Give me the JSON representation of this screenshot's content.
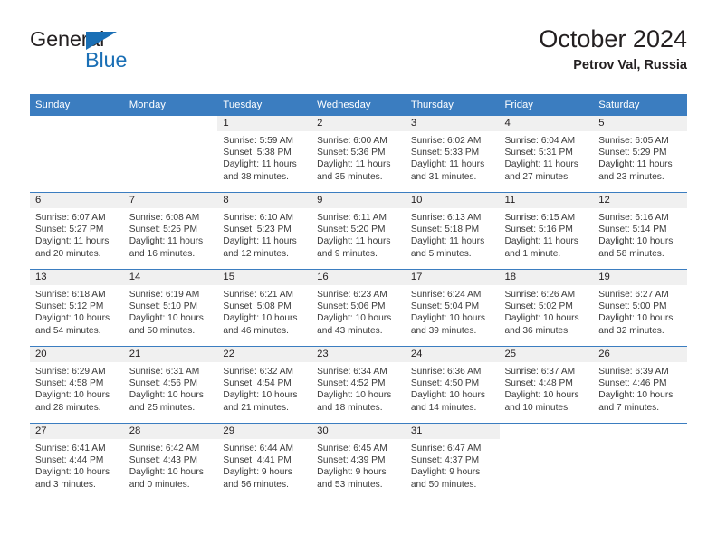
{
  "logo": {
    "word_primary": "General",
    "word_secondary": "Blue",
    "triangle_color": "#1a6fb5",
    "primary_color": "#231f20"
  },
  "header": {
    "title": "October 2024",
    "subtitle": "Petrov Val, Russia",
    "accent_color": "#3b7dc0"
  },
  "weekdays": [
    "Sunday",
    "Monday",
    "Tuesday",
    "Wednesday",
    "Thursday",
    "Friday",
    "Saturday"
  ],
  "labels": {
    "sunrise_prefix": "Sunrise:",
    "sunset_prefix": "Sunset:",
    "daylight_prefix": "Daylight:"
  },
  "weeks": [
    [
      {
        "day": "",
        "blank": true,
        "sunrise": "",
        "sunset": "",
        "daylight_line1": "",
        "daylight_line2": ""
      },
      {
        "day": "",
        "blank": true,
        "sunrise": "",
        "sunset": "",
        "daylight_line1": "",
        "daylight_line2": ""
      },
      {
        "day": "1",
        "sunrise": "Sunrise: 5:59 AM",
        "sunset": "Sunset: 5:38 PM",
        "daylight_line1": "Daylight: 11 hours",
        "daylight_line2": "and 38 minutes."
      },
      {
        "day": "2",
        "sunrise": "Sunrise: 6:00 AM",
        "sunset": "Sunset: 5:36 PM",
        "daylight_line1": "Daylight: 11 hours",
        "daylight_line2": "and 35 minutes."
      },
      {
        "day": "3",
        "sunrise": "Sunrise: 6:02 AM",
        "sunset": "Sunset: 5:33 PM",
        "daylight_line1": "Daylight: 11 hours",
        "daylight_line2": "and 31 minutes."
      },
      {
        "day": "4",
        "sunrise": "Sunrise: 6:04 AM",
        "sunset": "Sunset: 5:31 PM",
        "daylight_line1": "Daylight: 11 hours",
        "daylight_line2": "and 27 minutes."
      },
      {
        "day": "5",
        "sunrise": "Sunrise: 6:05 AM",
        "sunset": "Sunset: 5:29 PM",
        "daylight_line1": "Daylight: 11 hours",
        "daylight_line2": "and 23 minutes."
      }
    ],
    [
      {
        "day": "6",
        "sunrise": "Sunrise: 6:07 AM",
        "sunset": "Sunset: 5:27 PM",
        "daylight_line1": "Daylight: 11 hours",
        "daylight_line2": "and 20 minutes."
      },
      {
        "day": "7",
        "sunrise": "Sunrise: 6:08 AM",
        "sunset": "Sunset: 5:25 PM",
        "daylight_line1": "Daylight: 11 hours",
        "daylight_line2": "and 16 minutes."
      },
      {
        "day": "8",
        "sunrise": "Sunrise: 6:10 AM",
        "sunset": "Sunset: 5:23 PM",
        "daylight_line1": "Daylight: 11 hours",
        "daylight_line2": "and 12 minutes."
      },
      {
        "day": "9",
        "sunrise": "Sunrise: 6:11 AM",
        "sunset": "Sunset: 5:20 PM",
        "daylight_line1": "Daylight: 11 hours",
        "daylight_line2": "and 9 minutes."
      },
      {
        "day": "10",
        "sunrise": "Sunrise: 6:13 AM",
        "sunset": "Sunset: 5:18 PM",
        "daylight_line1": "Daylight: 11 hours",
        "daylight_line2": "and 5 minutes."
      },
      {
        "day": "11",
        "sunrise": "Sunrise: 6:15 AM",
        "sunset": "Sunset: 5:16 PM",
        "daylight_line1": "Daylight: 11 hours",
        "daylight_line2": "and 1 minute."
      },
      {
        "day": "12",
        "sunrise": "Sunrise: 6:16 AM",
        "sunset": "Sunset: 5:14 PM",
        "daylight_line1": "Daylight: 10 hours",
        "daylight_line2": "and 58 minutes."
      }
    ],
    [
      {
        "day": "13",
        "sunrise": "Sunrise: 6:18 AM",
        "sunset": "Sunset: 5:12 PM",
        "daylight_line1": "Daylight: 10 hours",
        "daylight_line2": "and 54 minutes."
      },
      {
        "day": "14",
        "sunrise": "Sunrise: 6:19 AM",
        "sunset": "Sunset: 5:10 PM",
        "daylight_line1": "Daylight: 10 hours",
        "daylight_line2": "and 50 minutes."
      },
      {
        "day": "15",
        "sunrise": "Sunrise: 6:21 AM",
        "sunset": "Sunset: 5:08 PM",
        "daylight_line1": "Daylight: 10 hours",
        "daylight_line2": "and 46 minutes."
      },
      {
        "day": "16",
        "sunrise": "Sunrise: 6:23 AM",
        "sunset": "Sunset: 5:06 PM",
        "daylight_line1": "Daylight: 10 hours",
        "daylight_line2": "and 43 minutes."
      },
      {
        "day": "17",
        "sunrise": "Sunrise: 6:24 AM",
        "sunset": "Sunset: 5:04 PM",
        "daylight_line1": "Daylight: 10 hours",
        "daylight_line2": "and 39 minutes."
      },
      {
        "day": "18",
        "sunrise": "Sunrise: 6:26 AM",
        "sunset": "Sunset: 5:02 PM",
        "daylight_line1": "Daylight: 10 hours",
        "daylight_line2": "and 36 minutes."
      },
      {
        "day": "19",
        "sunrise": "Sunrise: 6:27 AM",
        "sunset": "Sunset: 5:00 PM",
        "daylight_line1": "Daylight: 10 hours",
        "daylight_line2": "and 32 minutes."
      }
    ],
    [
      {
        "day": "20",
        "sunrise": "Sunrise: 6:29 AM",
        "sunset": "Sunset: 4:58 PM",
        "daylight_line1": "Daylight: 10 hours",
        "daylight_line2": "and 28 minutes."
      },
      {
        "day": "21",
        "sunrise": "Sunrise: 6:31 AM",
        "sunset": "Sunset: 4:56 PM",
        "daylight_line1": "Daylight: 10 hours",
        "daylight_line2": "and 25 minutes."
      },
      {
        "day": "22",
        "sunrise": "Sunrise: 6:32 AM",
        "sunset": "Sunset: 4:54 PM",
        "daylight_line1": "Daylight: 10 hours",
        "daylight_line2": "and 21 minutes."
      },
      {
        "day": "23",
        "sunrise": "Sunrise: 6:34 AM",
        "sunset": "Sunset: 4:52 PM",
        "daylight_line1": "Daylight: 10 hours",
        "daylight_line2": "and 18 minutes."
      },
      {
        "day": "24",
        "sunrise": "Sunrise: 6:36 AM",
        "sunset": "Sunset: 4:50 PM",
        "daylight_line1": "Daylight: 10 hours",
        "daylight_line2": "and 14 minutes."
      },
      {
        "day": "25",
        "sunrise": "Sunrise: 6:37 AM",
        "sunset": "Sunset: 4:48 PM",
        "daylight_line1": "Daylight: 10 hours",
        "daylight_line2": "and 10 minutes."
      },
      {
        "day": "26",
        "sunrise": "Sunrise: 6:39 AM",
        "sunset": "Sunset: 4:46 PM",
        "daylight_line1": "Daylight: 10 hours",
        "daylight_line2": "and 7 minutes."
      }
    ],
    [
      {
        "day": "27",
        "sunrise": "Sunrise: 6:41 AM",
        "sunset": "Sunset: 4:44 PM",
        "daylight_line1": "Daylight: 10 hours",
        "daylight_line2": "and 3 minutes."
      },
      {
        "day": "28",
        "sunrise": "Sunrise: 6:42 AM",
        "sunset": "Sunset: 4:43 PM",
        "daylight_line1": "Daylight: 10 hours",
        "daylight_line2": "and 0 minutes."
      },
      {
        "day": "29",
        "sunrise": "Sunrise: 6:44 AM",
        "sunset": "Sunset: 4:41 PM",
        "daylight_line1": "Daylight: 9 hours",
        "daylight_line2": "and 56 minutes."
      },
      {
        "day": "30",
        "sunrise": "Sunrise: 6:45 AM",
        "sunset": "Sunset: 4:39 PM",
        "daylight_line1": "Daylight: 9 hours",
        "daylight_line2": "and 53 minutes."
      },
      {
        "day": "31",
        "sunrise": "Sunrise: 6:47 AM",
        "sunset": "Sunset: 4:37 PM",
        "daylight_line1": "Daylight: 9 hours",
        "daylight_line2": "and 50 minutes."
      },
      {
        "day": "",
        "blank": true,
        "sunrise": "",
        "sunset": "",
        "daylight_line1": "",
        "daylight_line2": ""
      },
      {
        "day": "",
        "blank": true,
        "sunrise": "",
        "sunset": "",
        "daylight_line1": "",
        "daylight_line2": ""
      }
    ]
  ]
}
